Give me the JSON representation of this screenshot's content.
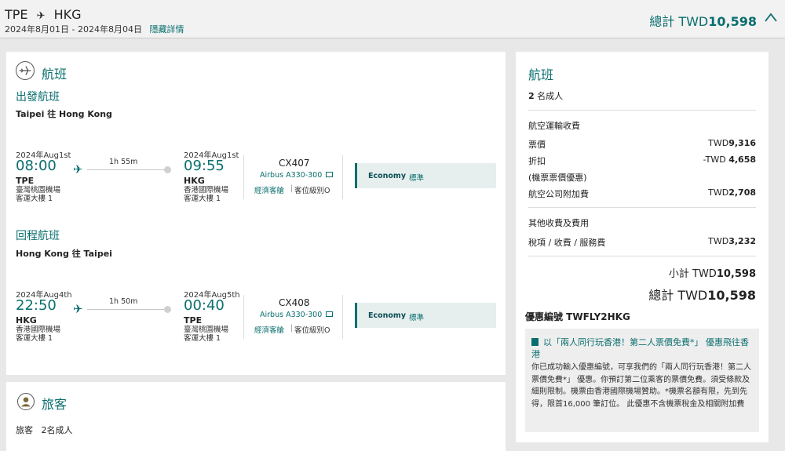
{
  "header": {
    "origin": "TPE",
    "destination": "HKG",
    "arrow": "✈",
    "dates": "2024年8月01日 - 2024年8月04日",
    "hide_details": "隱藏詳情",
    "total_label": "總計 TWD",
    "total_value": "10,598"
  },
  "flights": {
    "title": "航班",
    "outbound": {
      "title": "出發航班",
      "route": "Taipei 往 Hong Kong",
      "dep_date": "2024年Aug1st",
      "dep_time": "08:00",
      "dep_code": "TPE",
      "dep_airport": "臺灣桃園機場",
      "dep_terminal": "客運大樓 1",
      "duration": "1h 55m",
      "arr_date": "2024年Aug1st",
      "arr_time": "09:55",
      "arr_code": "HKG",
      "arr_airport": "香港國際機場",
      "arr_terminal": "客運大樓 1",
      "flight_no": "CX407",
      "aircraft": "Airbus A330-300",
      "cabin": "經濟客艙",
      "fare_class": "客位級別O",
      "fare_brand": "Economy",
      "fare_type": "標準"
    },
    "inbound": {
      "title": "回程航班",
      "route": "Hong Kong 往 Taipei",
      "dep_date": "2024年Aug4th",
      "dep_time": "22:50",
      "dep_code": "HKG",
      "dep_airport": "香港國際機場",
      "dep_terminal": "客運大樓 1",
      "duration": "1h 50m",
      "arr_date": "2024年Aug5th",
      "arr_time": "00:40",
      "arr_code": "TPE",
      "arr_airport": "臺灣桃園機場",
      "arr_terminal": "客運大樓 1",
      "flight_no": "CX408",
      "aircraft": "Airbus A330-300",
      "cabin": "經濟客艙",
      "fare_class": "客位級別O",
      "fare_brand": "Economy",
      "fare_type": "標準"
    }
  },
  "passengers": {
    "title": "旅客",
    "summary": "旅客   2名成人"
  },
  "pricing": {
    "title": "航班",
    "pax_count": "2",
    "pax_label": "名成人",
    "air_section": "航空運輸收費",
    "fare_label": "票價",
    "fare_cur": "TWD",
    "fare_value": "9,316",
    "discount_label": "折扣",
    "discount_cur": "-TWD ",
    "discount_value": "4,658",
    "discount_note": "(機票票價優惠)",
    "surcharge_label": "航空公司附加費",
    "surcharge_cur": "TWD",
    "surcharge_value": "2,708",
    "other_section": "其他收費及費用",
    "tax_label": "稅項 / 收費 / 服務費",
    "tax_cur": "TWD",
    "tax_value": "3,232",
    "subtotal_label": "小計 TWD",
    "subtotal_value": "10,598",
    "total_label": "總計 TWD",
    "total_value": "10,598",
    "promo_label": "優惠編號 TWFLY2HKG",
    "promo_head": "以「兩人同行玩香港！第二人票價免費*」 優惠飛往香港",
    "promo_body": "你已成功輸入優惠編號，可享我們的「兩人同行玩香港！第二人票價免費*」 優惠。你預訂第二位乘客的票價免費。須受條款及細則限制。機票由香港國際機場贊助。*機票名額有限，先到先得，限首16,000 筆訂位。 此優惠不含機票稅金及相關附加費"
  },
  "colors": {
    "brand": "#0b6e6e",
    "background": "#e8e8e8"
  }
}
